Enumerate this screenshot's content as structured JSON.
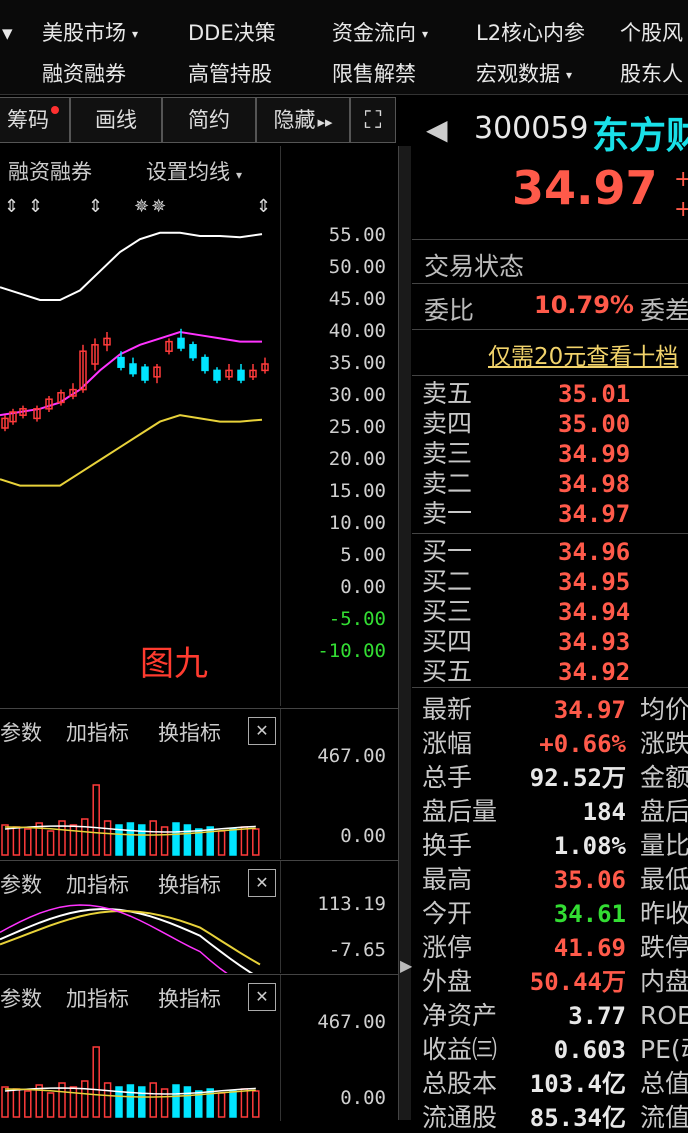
{
  "menu": {
    "row1": [
      "美股市场",
      "DDE决策",
      "资金流向",
      "L2核心内参",
      "个股风"
    ],
    "row2": [
      "融资融券",
      "高管持股",
      "限售解禁",
      "宏观数据",
      "股东人"
    ],
    "carets": "▾"
  },
  "toolbar": {
    "chips": "筹码",
    "draw": "画线",
    "simple": "简约",
    "hide": "隐藏",
    "hide_arrow": "▸▸",
    "expand": "⛶"
  },
  "main_chart": {
    "tab_margin": "融资融券",
    "tab_ma": "设置均线",
    "overlay_text": "图九",
    "axis": [
      "55.00",
      "50.00",
      "45.00",
      "40.00",
      "35.00",
      "30.00",
      "25.00",
      "20.00",
      "15.00",
      "10.00",
      "5.00",
      "0.00",
      "-5.00",
      "-10.00"
    ],
    "markers": "⇕ ⇕ ⇕ ✵✵ ⇕",
    "colors": {
      "up": "#ff3b3b",
      "down": "#00e5ff",
      "white": "#ffffff",
      "magenta": "#ff33ff",
      "yellow": "#e8d23a",
      "green": "#33dd33"
    }
  },
  "sub_panels": [
    {
      "params": "参数",
      "add": "加指标",
      "switch": "换指标",
      "close": "✕",
      "max": "467.00",
      "min": "0.00"
    },
    {
      "params": "参数",
      "add": "加指标",
      "switch": "换指标",
      "close": "✕",
      "max": "113.19",
      "min": "-7.65"
    },
    {
      "params": "参数",
      "add": "加指标",
      "switch": "换指标",
      "close": "✕",
      "max": "467.00",
      "min": "0.00"
    }
  ],
  "quote": {
    "code": "300059",
    "name": "东方财",
    "price": "34.97",
    "back_arrow": "◀",
    "trade_status": "交易状态",
    "weibi_label": "委比",
    "weibi_value": "10.79%",
    "weicha_label": "委差",
    "promo": "仅需20元查看十档",
    "sell": [
      {
        "label": "卖五",
        "price": "35.01"
      },
      {
        "label": "卖四",
        "price": "35.00"
      },
      {
        "label": "卖三",
        "price": "34.99"
      },
      {
        "label": "卖二",
        "price": "34.98"
      },
      {
        "label": "卖一",
        "price": "34.97"
      }
    ],
    "buy": [
      {
        "label": "买一",
        "price": "34.96"
      },
      {
        "label": "买二",
        "price": "34.95"
      },
      {
        "label": "买三",
        "price": "34.94"
      },
      {
        "label": "买四",
        "price": "34.93"
      },
      {
        "label": "买五",
        "price": "34.92"
      }
    ],
    "stats": [
      {
        "label": "最新",
        "value": "34.97",
        "color": "#ff5a4a",
        "label2": "均价"
      },
      {
        "label": "涨幅",
        "value": "+0.66%",
        "color": "#ff5a4a",
        "label2": "涨跌"
      },
      {
        "label": "总手",
        "value": "92.52万",
        "color": "#e8e8e8",
        "label2": "金额"
      },
      {
        "label": "盘后量",
        "value": "184",
        "color": "#e8e8e8",
        "label2": "盘后"
      },
      {
        "label": "换手",
        "value": "1.08%",
        "color": "#e8e8e8",
        "label2": "量比"
      },
      {
        "label": "最高",
        "value": "35.06",
        "color": "#ff5a4a",
        "label2": "最低"
      },
      {
        "label": "今开",
        "value": "34.61",
        "color": "#33dd33",
        "label2": "昨收"
      },
      {
        "label": "涨停",
        "value": "41.69",
        "color": "#ff5a4a",
        "label2": "跌停"
      },
      {
        "label": "外盘",
        "value": "50.44万",
        "color": "#ff5a4a",
        "label2": "内盘"
      },
      {
        "label": "净资产",
        "value": "3.77",
        "color": "#e8e8e8",
        "label2": "ROE"
      },
      {
        "label": "收益㈢",
        "value": "0.603",
        "color": "#e8e8e8",
        "label2": "PE(动"
      },
      {
        "label": "总股本",
        "value": "103.4亿",
        "color": "#e8e8e8",
        "label2": "总值"
      },
      {
        "label": "流通股",
        "value": "85.34亿",
        "color": "#e8e8e8",
        "label2": "流值"
      }
    ]
  }
}
